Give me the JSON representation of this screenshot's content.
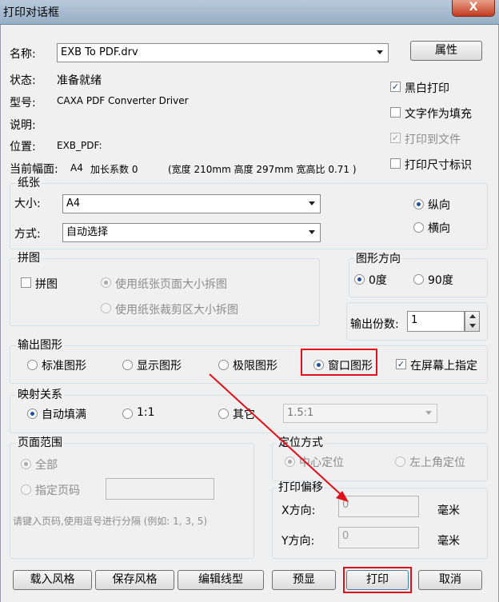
{
  "window": {
    "title": "打印对话框",
    "close_label": "X"
  },
  "printer": {
    "name_label": "名称:",
    "name_value": "EXB To PDF.drv",
    "properties_button": "属性",
    "status_label": "状态:",
    "status_value": "准备就绪",
    "type_label": "型号:",
    "type_value": "CAXA PDF Converter Driver",
    "comment_label": "说明:",
    "location_label": "位置:",
    "location_value": "EXB_PDF:",
    "current_label": "当前幅面:",
    "current_size": "A4",
    "factor_text": "加长系数 0",
    "dims_text": "(宽度 210mm  高度 297mm  宽高比 0.71 )"
  },
  "options": {
    "mono": "黑白打印",
    "text_fill": "文字作为填充",
    "to_file": "打印到文件",
    "size_mark": "打印尺寸标识"
  },
  "paper": {
    "title": "纸张",
    "size_label": "大小:",
    "size_value": "A4",
    "method_label": "方式:",
    "method_value": "自动选择",
    "portrait": "纵向",
    "landscape": "横向"
  },
  "tiling": {
    "title": "拼图",
    "checkbox": "拼图",
    "option_page": "使用纸张页面大小拆图",
    "option_crop": "使用纸张裁剪区大小拆图"
  },
  "orientation": {
    "title": "图形方向",
    "deg0": "0度",
    "deg90": "90度"
  },
  "copies": {
    "label": "输出份数:",
    "value": "1"
  },
  "output": {
    "title": "输出图形",
    "standard": "标准图形",
    "display": "显示图形",
    "limits": "极限图形",
    "window": "窗口图形",
    "on_screen": "在屏幕上指定"
  },
  "mapping": {
    "title": "映射关系",
    "auto_fill": "自动填满",
    "one_to_one": "1:1",
    "other": "其它",
    "ratio_value": "1.5:1"
  },
  "page_range": {
    "title": "页面范围",
    "all": "全部",
    "specified": "指定页码",
    "hint": "请键入页码,使用逗号进行分隔 (例如: 1, 3, 5)"
  },
  "position": {
    "title": "定位方式",
    "center": "中心定位",
    "top_left": "左上角定位"
  },
  "offset": {
    "title": "打印偏移",
    "x_label": "X方向:",
    "x_value": "0",
    "y_label": "Y方向:",
    "y_value": "0",
    "unit": "毫米"
  },
  "buttons": {
    "load_style": "载入风格",
    "save_style": "保存风格",
    "edit_linetype": "编辑线型",
    "preview": "预显",
    "print": "打印",
    "cancel": "取消"
  },
  "colors": {
    "annotation": "#e0101a",
    "accent": "#1f4e9d"
  }
}
